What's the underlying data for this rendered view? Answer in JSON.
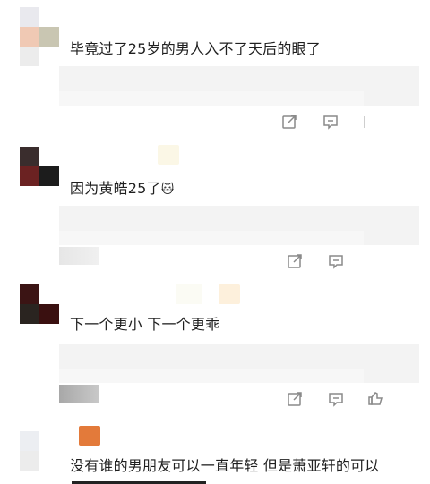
{
  "comments": [
    {
      "text": "毕竟过了25岁的男人入不了天后的眼了"
    },
    {
      "text": "因为黄皓25了",
      "emoji": "🐱"
    },
    {
      "text": "下一个更小 下一个更乖"
    },
    {
      "text": "没有谁的男朋友可以一直年轻 但是萧亚轩的可以"
    }
  ],
  "icons": {
    "share": "share-icon",
    "comment": "comment-icon",
    "like": "like-icon"
  },
  "colors": {
    "background": "#ffffff",
    "text": "#1f1f1f",
    "icon": "#8a8a8a",
    "quote_bg": "#f3f3f3"
  }
}
